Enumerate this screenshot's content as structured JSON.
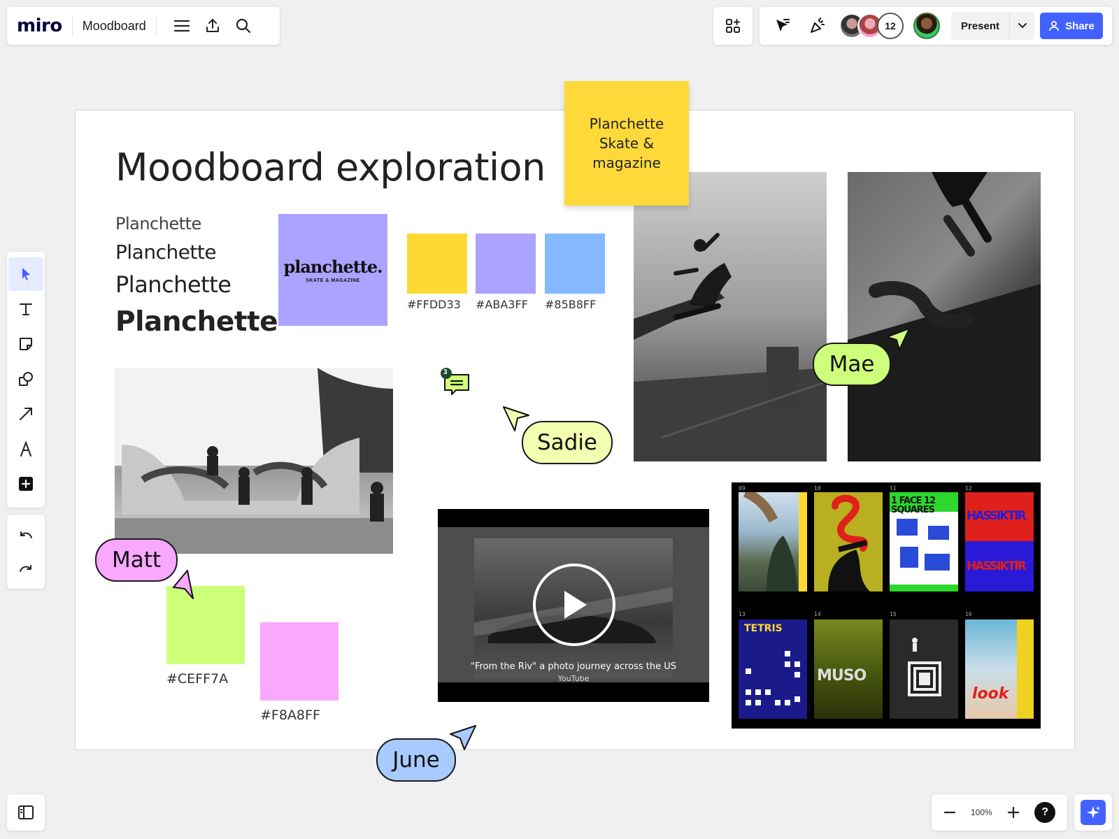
{
  "app": {
    "logo": "miro",
    "board_name": "Moodboard"
  },
  "collaborators": {
    "count": "12"
  },
  "toolbar": {
    "present_label": "Present",
    "share_label": "Share"
  },
  "zoom": {
    "level": "100%"
  },
  "help": {
    "label": "?"
  },
  "board": {
    "title": "Moodboard exploration",
    "type_samples": [
      "Planchette",
      "Planchette",
      "Planchette",
      "Planchette"
    ],
    "logo_card": {
      "wordmark": "planchette.",
      "subtitle": "SKATE & MAGAZINE"
    },
    "sticky_note": "Planchette Skate & magazine",
    "swatches": [
      {
        "hex": "#FFD933",
        "label": "#FFDD33"
      },
      {
        "hex": "#ABA3FF",
        "label": "#ABA3FF"
      },
      {
        "hex": "#85B8FF",
        "label": "#85B8FF"
      },
      {
        "hex": "#CEFF7A",
        "label": "#CEFF7A"
      },
      {
        "hex": "#F8A8FF",
        "label": "#F8A8FF"
      }
    ],
    "comment_count": "3",
    "video": {
      "title": "\"From the Riv\" a photo journey across the US",
      "source": "YouTube"
    },
    "posters": {
      "numbers": [
        "09",
        "10",
        "11",
        "12",
        "13",
        "14",
        "15",
        "16"
      ],
      "p11_text": "1 FACE 12 SQUARES",
      "p12_text": "HASSIKTIR",
      "p12_text2": "HASSIKTIR",
      "p13_text": "TETRIS",
      "p14_text": "MUSO",
      "p16_text": "look"
    }
  },
  "cursors": [
    {
      "name": "Mae",
      "color": "#ceff7a"
    },
    {
      "name": "Sadie",
      "color": "#f3ffb0"
    },
    {
      "name": "Matt",
      "color": "#f8a8ff"
    },
    {
      "name": "June",
      "color": "#a8cbff"
    }
  ]
}
